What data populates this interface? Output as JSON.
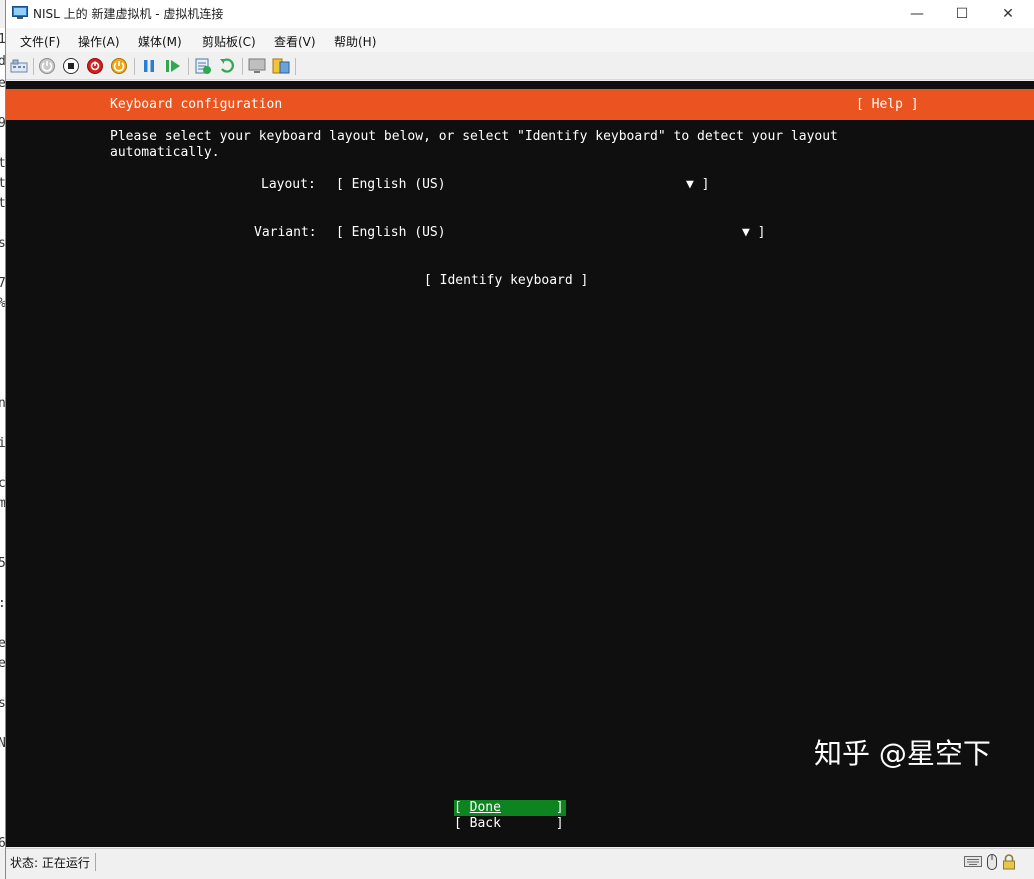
{
  "window": {
    "title": "NISL 上的 新建虚拟机 - 虚拟机连接",
    "minimize": "—",
    "maximize": "☐",
    "close": "✕"
  },
  "menu": [
    "文件(F)",
    "操作(A)",
    "媒体(M)",
    "剪贴板(C)",
    "查看(V)",
    "帮助(H)"
  ],
  "toolbar_icons": [
    "ctrl-alt-del-icon",
    "start-icon",
    "turn-off-icon",
    "shut-down-icon",
    "save-icon",
    "pause-icon",
    "resume-icon",
    "checkpoint-icon",
    "revert-icon",
    "enhanced-session-icon",
    "share-icon"
  ],
  "installer": {
    "header_title": "Keyboard configuration",
    "help": "[ Help ]",
    "intro_line1": "Please select your keyboard layout below, or select \"Identify keyboard\" to detect your layout",
    "intro_line2": "automatically.",
    "layout_label": "Layout:",
    "layout_value": "[ English (US)",
    "layout_arrow": "▼ ]",
    "variant_label": "Variant:",
    "variant_value": "[ English (US)",
    "variant_arrow": "▼ ]",
    "identify": "[ Identify keyboard ]",
    "done_open": "[ ",
    "done_label": "Done",
    "done_close": "       ]",
    "back": "[ Back       ]"
  },
  "watermark": "知乎 @星空下",
  "status": {
    "text": "状态: 正在运行"
  },
  "background_window_chars": [
    "1",
    "d",
    "e",
    "9",
    "t",
    "t",
    "t",
    "s",
    "7",
    "%",
    "n",
    "i",
    "c",
    "m",
    "5",
    ":",
    "e",
    "e",
    "s",
    "N",
    "6"
  ],
  "colors": {
    "accent": "#e95420",
    "button_selected": "#0e8420",
    "screen_bg": "#0f0f0f"
  }
}
